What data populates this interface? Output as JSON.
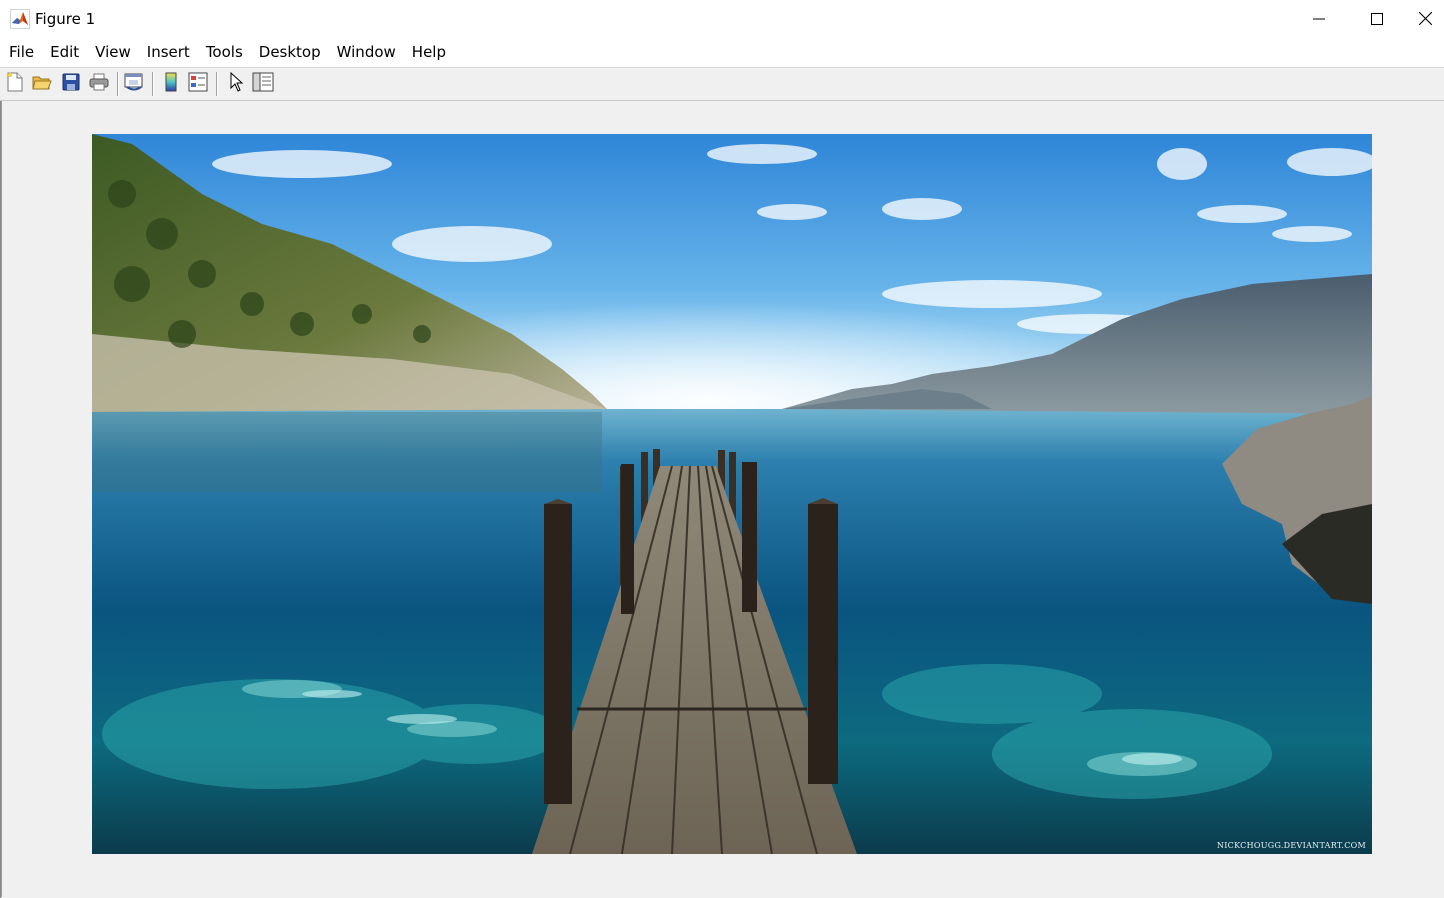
{
  "window": {
    "title": "Figure 1",
    "app_icon": "matlab-icon",
    "controls": [
      "minimize-icon",
      "maximize-icon",
      "close-icon"
    ]
  },
  "menu": {
    "items": [
      "File",
      "Edit",
      "View",
      "Insert",
      "Tools",
      "Desktop",
      "Window",
      "Help"
    ]
  },
  "toolbar": {
    "buttons": [
      "new-figure-icon",
      "open-file-icon",
      "save-icon",
      "print-icon",
      "link-plot-icon",
      "insert-colorbar-icon",
      "insert-legend-icon",
      "edit-plot-cursor-icon",
      "property-inspector-icon"
    ]
  },
  "figure": {
    "image_description": "wooden pier extending into clear turquoise sea between rocky hills under blue sky",
    "watermark": "NICKCHOUGG.DEVIANTART.COM"
  },
  "colors": {
    "titlebar_bg": "#ffffff",
    "figure_bg": "#f0f0f0",
    "sky_top": "#2f86d8",
    "sea_deep": "#0a4f7a",
    "sea_shallow": "#1e8fa0"
  }
}
